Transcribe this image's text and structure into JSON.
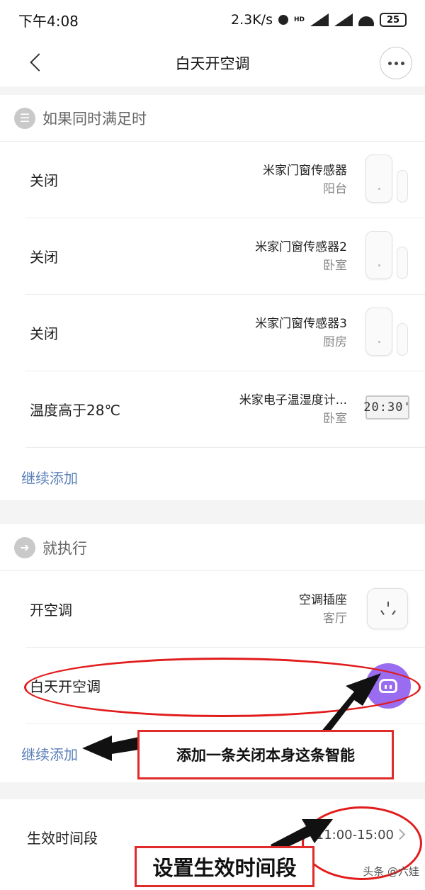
{
  "status_bar": {
    "time": "下午4:08",
    "network_speed": "2.3K/s",
    "hd_label": "HD",
    "battery": "25"
  },
  "nav": {
    "title": "白天开空调"
  },
  "conditions": {
    "header": "如果同时满足时",
    "items": [
      {
        "label": "关闭",
        "device": "米家门窗传感器",
        "room": "阳台",
        "icon": "door-window-sensor-icon"
      },
      {
        "label": "关闭",
        "device": "米家门窗传感器2",
        "room": "卧室",
        "icon": "door-window-sensor-icon"
      },
      {
        "label": "关闭",
        "device": "米家门窗传感器3",
        "room": "厨房",
        "icon": "door-window-sensor-icon"
      },
      {
        "label": "温度高于28℃",
        "device": "米家电子温湿度计...",
        "room": "卧室",
        "icon": "thermometer-display-icon",
        "display": "20:30'"
      }
    ],
    "add_label": "继续添加"
  },
  "actions": {
    "header": "就执行",
    "items": [
      {
        "label": "开空调",
        "device": "空调插座",
        "room": "客厅",
        "icon": "smart-plug-icon"
      },
      {
        "label": "白天开空调",
        "icon": "smart-scene-robot-icon"
      }
    ],
    "add_label": "继续添加"
  },
  "schedule": {
    "label": "生效时间段",
    "value": "11:00-15:00"
  },
  "annotations": {
    "add_self": "添加一条关闭本身这条智能",
    "set_time": "设置生效时间段",
    "color": "#e12a2a"
  },
  "watermark": "头条 @六娃",
  "colors": {
    "link": "#5b7fb8",
    "robot_button": "#9a6cf0"
  }
}
